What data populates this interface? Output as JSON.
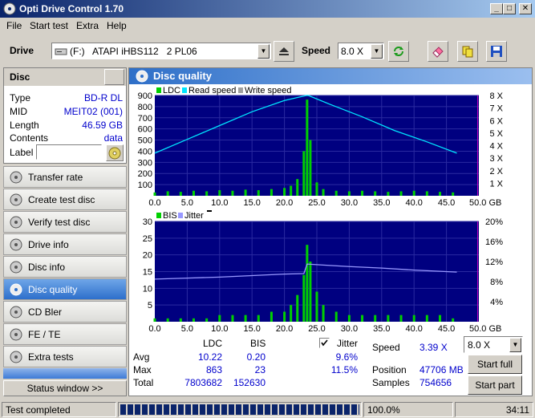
{
  "window": {
    "title": "Opti Drive Control 1.70"
  },
  "menu": [
    "File",
    "Start test",
    "Extra",
    "Help"
  ],
  "toolbar": {
    "drive_label": "Drive",
    "drive_value": "(F:)   ATAPI iHBS112   2 PL06",
    "speed_label": "Speed",
    "speed_value": "8.0 X"
  },
  "disc": {
    "heading": "Disc",
    "rows": [
      {
        "label": "Type",
        "value": "BD-R DL"
      },
      {
        "label": "MID",
        "value": "MEIT02 (001)"
      },
      {
        "label": "Length",
        "value": "46.59 GB"
      },
      {
        "label": "Contents",
        "value": "data"
      }
    ],
    "label_label": "Label",
    "label_value": ""
  },
  "nav": [
    "Transfer rate",
    "Create test disc",
    "Verify test disc",
    "Drive info",
    "Disc info",
    "Disc quality",
    "CD Bler",
    "FE / TE",
    "Extra tests"
  ],
  "nav_active": "Disc quality",
  "status_window_button": "Status window >>",
  "panel_title": "Disc quality",
  "chart_data": [
    {
      "type": "line",
      "legend": [
        "LDC",
        "Read speed",
        "Write speed"
      ],
      "colors": {
        "LDC": "#00d000",
        "Read speed": "#00e5ff",
        "Write speed": "#a0a0a0",
        "background": "#000080"
      },
      "xlim": [
        0,
        50
      ],
      "ylim": [
        0,
        900
      ],
      "y2lim": [
        0,
        8
      ],
      "x_ticks": [
        "0.0",
        "5.0",
        "10.0",
        "15.0",
        "20.0",
        "25.0",
        "30.0",
        "35.0",
        "40.0",
        "45.0",
        "50.0 GB"
      ],
      "y_ticks": [
        "100",
        "200",
        "300",
        "400",
        "500",
        "600",
        "700",
        "800",
        "900"
      ],
      "y2_ticks": [
        "1 X",
        "2 X",
        "3 X",
        "4 X",
        "5 X",
        "6 X",
        "7 X",
        "8 X"
      ],
      "series": [
        {
          "name": "Read speed",
          "x": [
            0,
            5,
            10,
            15,
            20,
            23.4,
            23.7,
            27,
            32,
            37,
            42,
            46.6
          ],
          "y": [
            3.4,
            4.5,
            5.6,
            6.7,
            7.6,
            8.0,
            8.0,
            7.3,
            6.3,
            5.2,
            4.3,
            3.4
          ]
        },
        {
          "name": "LDC",
          "x": [
            0,
            2,
            4,
            6,
            8,
            10,
            12,
            14,
            16,
            18,
            20,
            21,
            22,
            23,
            23.5,
            24,
            25,
            26,
            28,
            30,
            32,
            34,
            36,
            38,
            40,
            42,
            44,
            46
          ],
          "y": [
            30,
            40,
            35,
            45,
            40,
            50,
            45,
            55,
            50,
            60,
            70,
            90,
            150,
            400,
            863,
            500,
            120,
            60,
            45,
            40,
            45,
            40,
            35,
            40,
            45,
            40,
            35,
            30
          ]
        }
      ]
    },
    {
      "type": "line",
      "legend": [
        "BIS",
        "Jitter"
      ],
      "colors": {
        "BIS": "#00d000",
        "Jitter": "#9999ff",
        "background": "#000080"
      },
      "xlim": [
        0,
        50
      ],
      "ylim": [
        0,
        30
      ],
      "y2lim": [
        0,
        20
      ],
      "x_ticks": [
        "0.0",
        "5.0",
        "10.0",
        "15.0",
        "20.0",
        "25.0",
        "30.0",
        "35.0",
        "40.0",
        "45.0",
        "50.0 GB"
      ],
      "y_ticks": [
        "5",
        "10",
        "15",
        "20",
        "25",
        "30"
      ],
      "y2_ticks": [
        "4%",
        "8%",
        "12%",
        "16%",
        "20%"
      ],
      "series": [
        {
          "name": "Jitter",
          "x": [
            0,
            5,
            10,
            15,
            20,
            23,
            23.5,
            26,
            30,
            35,
            40,
            46.6
          ],
          "y": [
            8.5,
            8.7,
            8.9,
            9.2,
            9.5,
            9.6,
            11.5,
            11.3,
            11.0,
            10.7,
            10.3,
            9.9
          ]
        },
        {
          "name": "BIS",
          "x": [
            0,
            2,
            4,
            6,
            8,
            10,
            12,
            14,
            16,
            18,
            20,
            21,
            22,
            23,
            23.5,
            24,
            25,
            26,
            28,
            30,
            32,
            34,
            36,
            38,
            40,
            42,
            44,
            46
          ],
          "y": [
            1,
            1,
            1,
            1,
            1,
            2,
            2,
            2,
            2,
            3,
            3,
            5,
            8,
            14,
            23,
            18,
            9,
            5,
            3,
            2,
            2,
            2,
            2,
            2,
            2,
            2,
            2,
            1
          ]
        }
      ]
    }
  ],
  "stats": {
    "col_ldc": "LDC",
    "col_bis": "BIS",
    "avg_label": "Avg",
    "max_label": "Max",
    "total_label": "Total",
    "avg_ldc": "10.22",
    "avg_bis": "0.20",
    "max_ldc": "863",
    "max_bis": "23",
    "total_ldc": "7803682",
    "total_bis": "152630",
    "jitter_label": "Jitter",
    "jitter_avg": "9.6%",
    "jitter_max": "11.5%",
    "speed_label": "Speed",
    "speed_value": "3.39 X",
    "position_label": "Position",
    "position_value": "47706 MB",
    "samples_label": "Samples",
    "samples_value": "754656",
    "speed_select": "8.0 X"
  },
  "buttons": {
    "start_full": "Start full",
    "start_part": "Start part"
  },
  "statusbar": {
    "text": "Test completed",
    "progress": 1.0,
    "percent": "100.0%",
    "time": "34:11"
  }
}
